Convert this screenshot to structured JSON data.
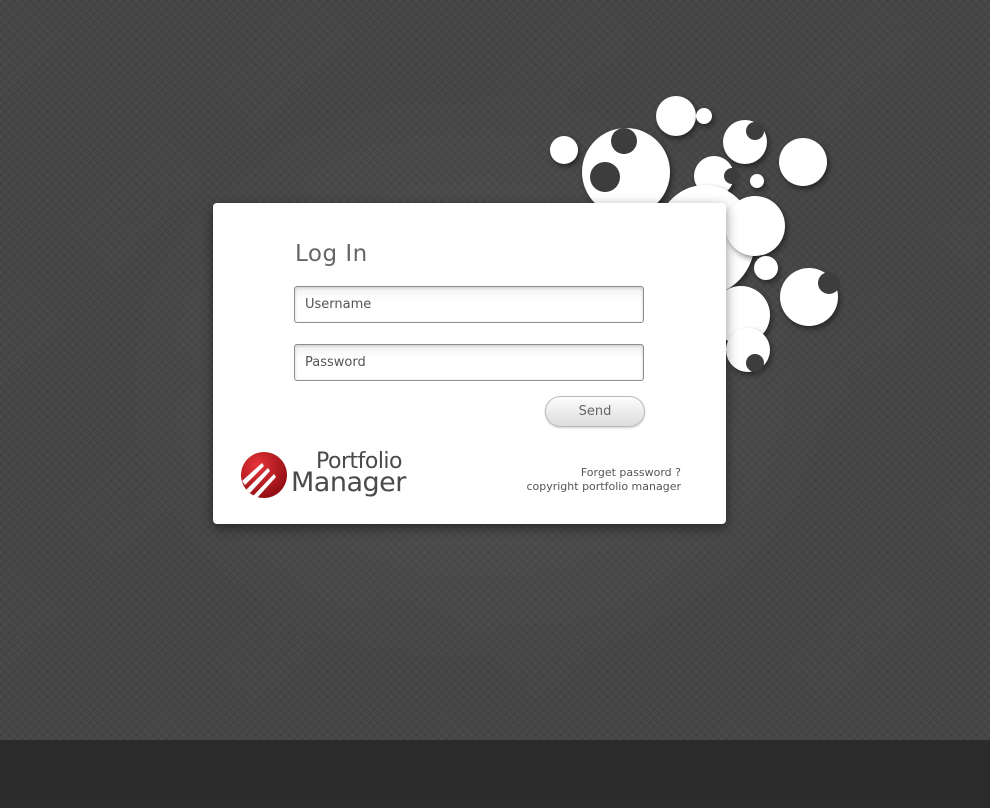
{
  "login": {
    "title": "Log In",
    "username_placeholder": "Username",
    "password_placeholder": "Password",
    "send_label": "Send"
  },
  "brand": {
    "line1": "Portfolio",
    "line2": "Manager",
    "accent_color": "#c8161d"
  },
  "footer_links": {
    "forgot_password": "Forget password ?",
    "copyright": "copyright portfolio manager"
  },
  "colors": {
    "background": "#464646",
    "footer_band": "#2b2b2b",
    "card": "#ffffff"
  }
}
